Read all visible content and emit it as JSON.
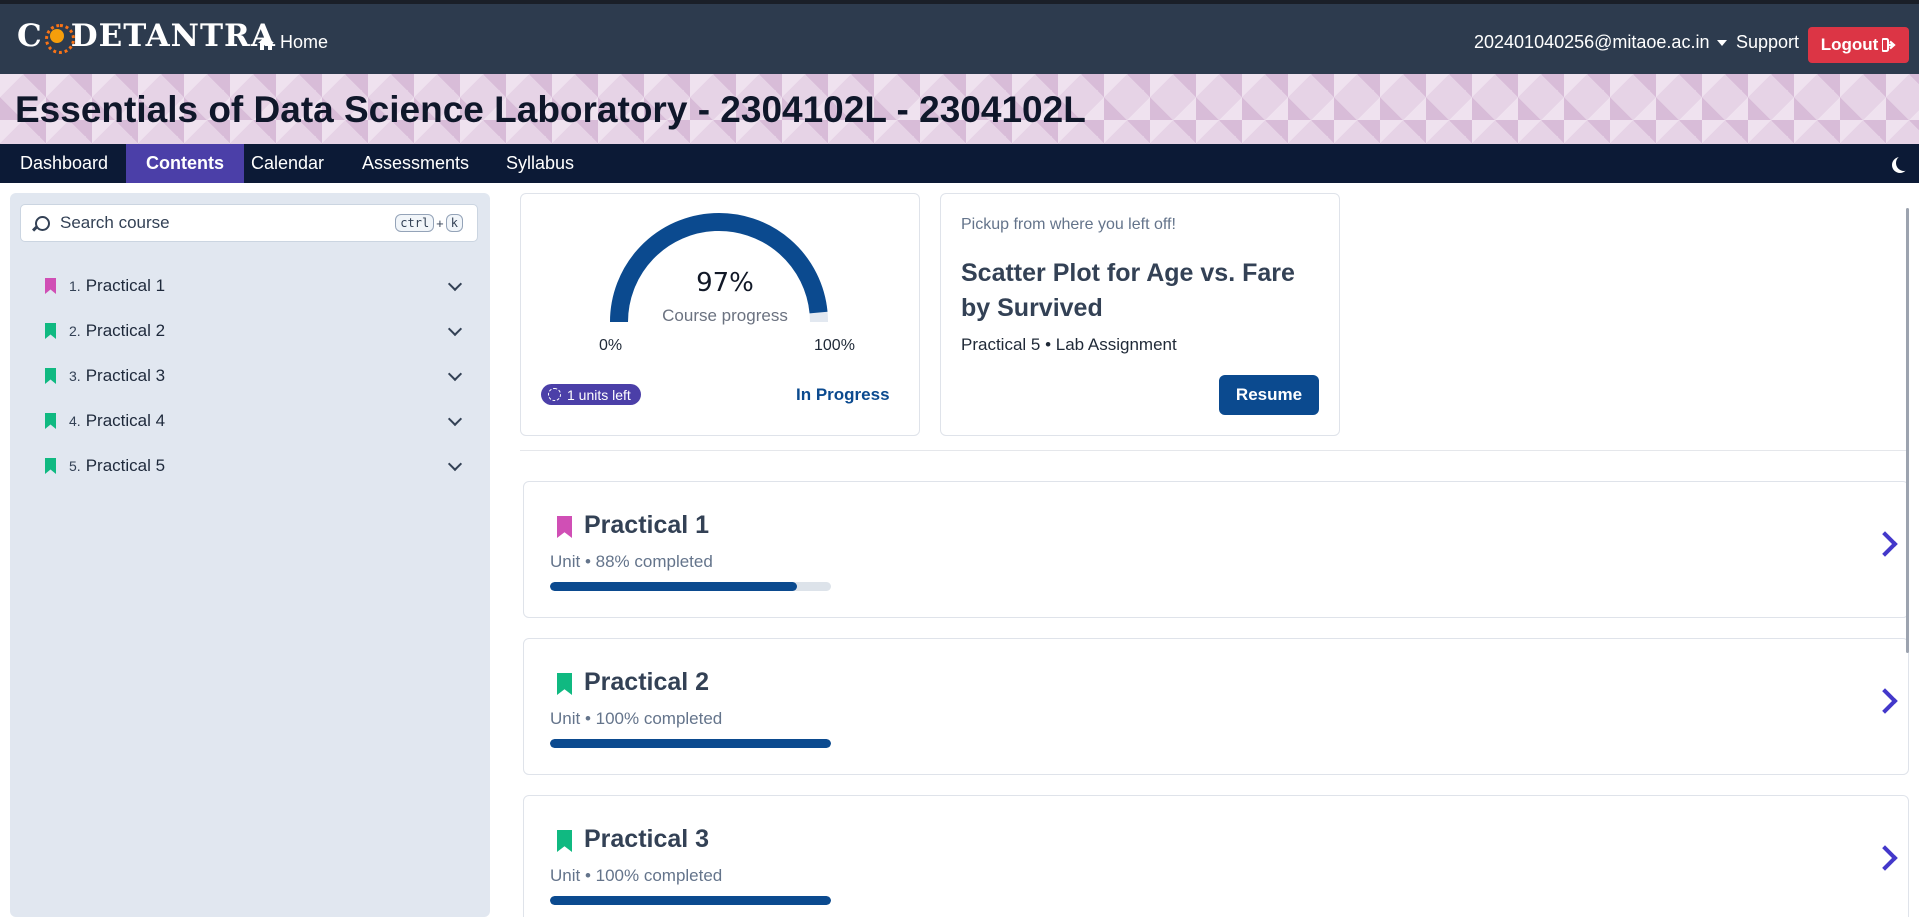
{
  "header": {
    "logo_text": "CODETANTRA",
    "home_label": "Home",
    "user_email": "202401040256@mitaoe.ac.in",
    "support_label": "Support",
    "logout_label": "Logout"
  },
  "banner": {
    "title": "Essentials of Data Science Laboratory - 2304102L - 2304102L"
  },
  "tabs": [
    {
      "label": "Dashboard",
      "active": false
    },
    {
      "label": "Contents",
      "active": true
    },
    {
      "label": "Calendar",
      "active": false
    },
    {
      "label": "Assessments",
      "active": false
    },
    {
      "label": "Syllabus",
      "active": false
    }
  ],
  "sidebar": {
    "search_placeholder": "Search course",
    "shortcut_key1": "ctrl",
    "shortcut_plus": "+",
    "shortcut_key2": "k",
    "items": [
      {
        "num": "1.",
        "label": "Practical 1",
        "color": "#d04fb5"
      },
      {
        "num": "2.",
        "label": "Practical 2",
        "color": "#10b981"
      },
      {
        "num": "3.",
        "label": "Practical 3",
        "color": "#10b981"
      },
      {
        "num": "4.",
        "label": "Practical 4",
        "color": "#10b981"
      },
      {
        "num": "5.",
        "label": "Practical 5",
        "color": "#10b981"
      }
    ]
  },
  "progress_card": {
    "percent_text": "97%",
    "percent_value": 0.97,
    "label": "Course progress",
    "min_label": "0%",
    "max_label": "100%",
    "units_left": "1 units left",
    "status": "In Progress",
    "accent": "#0b4a8f"
  },
  "resume_card": {
    "pickup_text": "Pickup from where you left off!",
    "title": "Scatter Plot for Age vs. Fare by Survived",
    "subtitle": "Practical 5 • Lab Assignment",
    "button_label": "Resume"
  },
  "units": [
    {
      "title": "Practical 1",
      "subtitle": "Unit • 88% completed",
      "progress": 0.88,
      "color": "#d04fb5"
    },
    {
      "title": "Practical 2",
      "subtitle": "Unit • 100% completed",
      "progress": 1.0,
      "color": "#10b981"
    },
    {
      "title": "Practical 3",
      "subtitle": "Unit • 100% completed",
      "progress": 1.0,
      "color": "#10b981"
    }
  ]
}
